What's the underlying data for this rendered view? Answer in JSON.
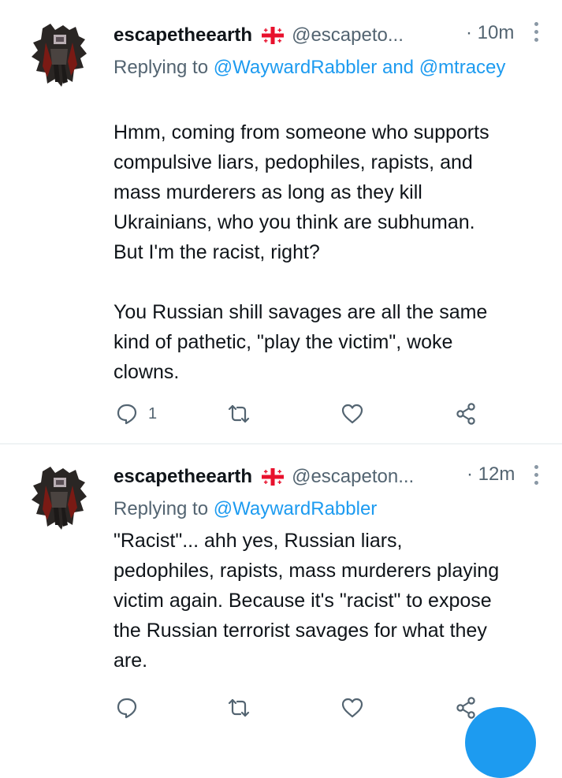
{
  "tweets": [
    {
      "display_name": "escapetheearth",
      "handle": "@escapeto...",
      "time": "· 10m",
      "reply_prefix": "Replying to ",
      "reply_mention_1": "@WaywardRabbler",
      "reply_and": " and ",
      "reply_mention_2": "@mtracey",
      "text": "Hmm, coming from someone who supports\ncompulsive liars, pedophiles, rapists, and\nmass murderers as long as they kill\nUkrainians, who you think are subhuman.\nBut I'm the racist, right?\n\nYou Russian shill savages are all the same\nkind of pathetic, \"play the victim\", woke\nclowns.",
      "reply_count": "1"
    },
    {
      "display_name": "escapetheearth",
      "handle": "@escapeton...",
      "time": "· 12m",
      "reply_prefix": "Replying to ",
      "reply_mention_1": "@WaywardRabbler",
      "text": "\"Racist\"... ahh yes, Russian liars,\npedophiles, rapists, mass murderers playing\nvictim again. Because it's \"racist\" to expose\nthe Russian terrorist savages for what they\nare."
    }
  ],
  "icons": {
    "reply": "reply-icon",
    "retweet": "retweet-icon",
    "like": "like-icon",
    "share": "share-icon",
    "more": "more-icon",
    "flag": "georgia-flag-icon"
  },
  "colors": {
    "link": "#1d9bf0",
    "muted": "#536471",
    "text": "#0f1419",
    "flag_red": "#e8112d"
  }
}
